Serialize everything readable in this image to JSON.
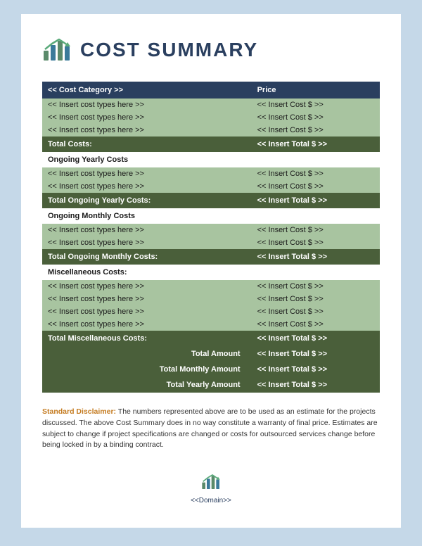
{
  "header": {
    "title": "COST SUMMARY",
    "domain": "<<Domain>>"
  },
  "table": {
    "col_category": "<< Cost Category >>",
    "col_price": "Price",
    "sections": [
      {
        "type": "data-rows",
        "rows": [
          {
            "category": "<< Insert cost types here >>",
            "price": "<< Insert Cost $ >>"
          },
          {
            "category": "<< Insert cost types here >>",
            "price": "<< Insert Cost $ >>"
          },
          {
            "category": "<< Insert cost types here >>",
            "price": "<< Insert Cost $ >>"
          }
        ],
        "total_label": "Total Costs:",
        "total_value": "<< Insert Total $ >>"
      },
      {
        "heading": "Ongoing Yearly Costs",
        "rows": [
          {
            "category": "<< Insert cost types here >>",
            "price": "<< Insert Cost $ >>"
          },
          {
            "category": "<< Insert cost types here >>",
            "price": "<< Insert Cost $ >>"
          }
        ],
        "total_label": "Total Ongoing Yearly Costs:",
        "total_value": "<< Insert Total $ >>"
      },
      {
        "heading": "Ongoing Monthly Costs",
        "rows": [
          {
            "category": "<< Insert cost types here >>",
            "price": "<< Insert Cost $ >>"
          },
          {
            "category": "<< Insert cost types here >>",
            "price": "<< Insert Cost $ >>"
          }
        ],
        "total_label": "Total Ongoing Monthly Costs:",
        "total_value": "<< Insert Total $ >>"
      },
      {
        "heading": "Miscellaneous Costs:",
        "rows": [
          {
            "category": "<< Insert cost types here >>",
            "price": "<< Insert Cost $ >>"
          },
          {
            "category": "<< Insert cost types here >>",
            "price": "<< Insert Cost $ >>"
          },
          {
            "category": "<< Insert cost types here >>",
            "price": "<< Insert Cost $ >>"
          },
          {
            "category": "<< Insert cost types here >>",
            "price": "<< Insert Cost $ >>"
          }
        ],
        "total_label": "Total Miscellaneous Costs:",
        "total_value": "<< Insert Total $ >>"
      }
    ],
    "summary_rows": [
      {
        "label": "Total Amount",
        "value": "<< Insert Total $ >>"
      },
      {
        "label": "Total Monthly Amount",
        "value": "<< Insert Total $ >>"
      },
      {
        "label": "Total Yearly Amount",
        "value": "<< Insert Total $ >>"
      }
    ]
  },
  "disclaimer": {
    "label": "Standard Disclaimer:",
    "text": " The numbers represented above are to be used as an estimate for the projects discussed. The above Cost Summary does in no way constitute a warranty of final price.  Estimates are subject to change if project specifications are changed or costs for outsourced services change before being locked in by a binding contract."
  }
}
